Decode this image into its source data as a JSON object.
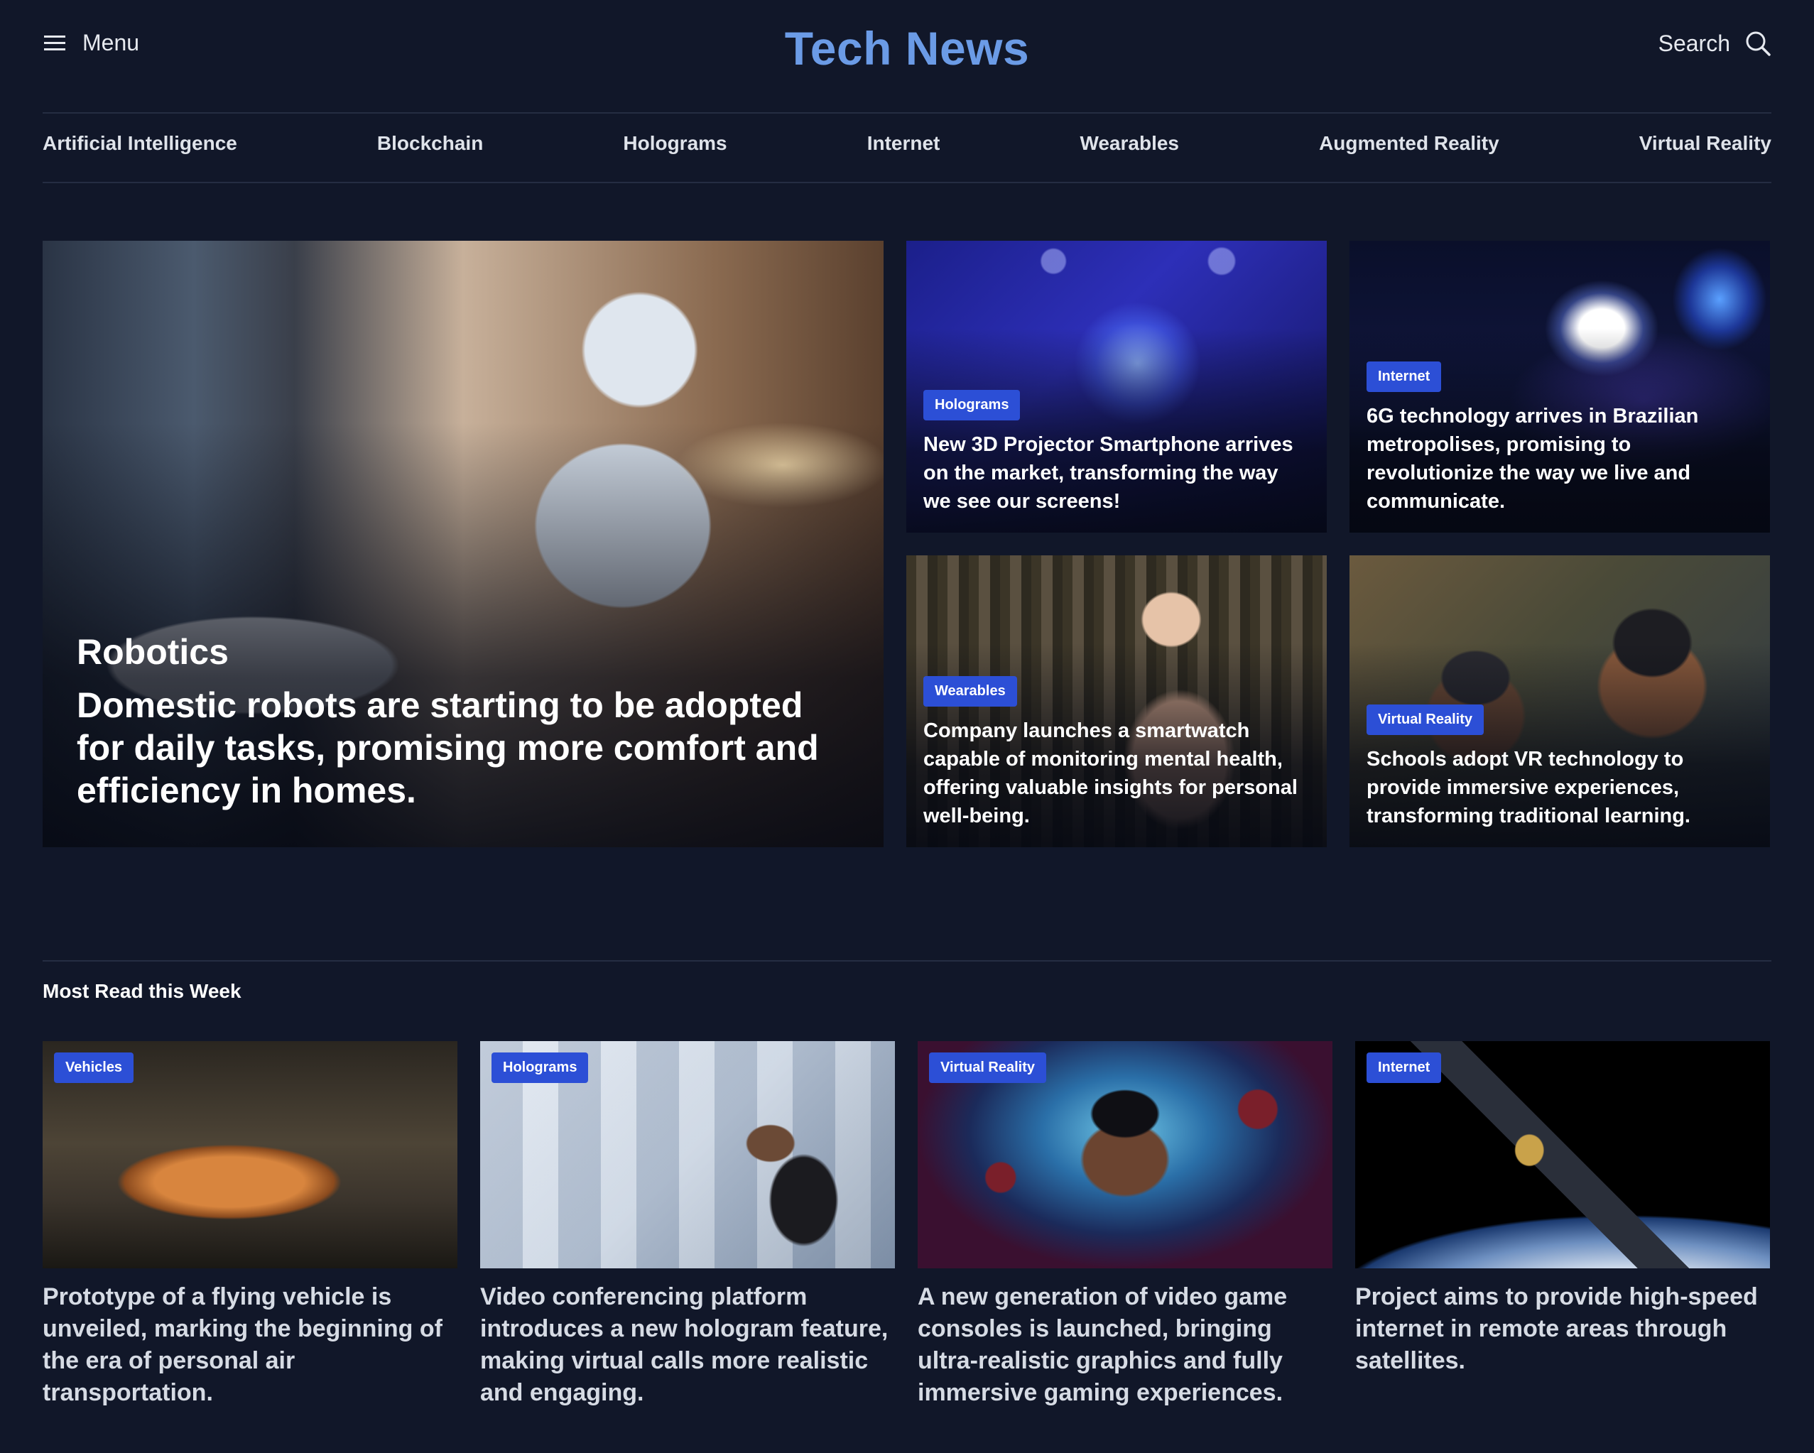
{
  "header": {
    "menu_label": "Menu",
    "logo": "Tech News",
    "search_label": "Search"
  },
  "nav": [
    "Artificial Intelligence",
    "Blockchain",
    "Holograms",
    "Internet",
    "Wearables",
    "Augmented Reality",
    "Virtual Reality"
  ],
  "featured": {
    "category": "Robotics",
    "title": "Domestic robots are starting to be adopted for daily tasks, promising more comfort and efficiency in homes."
  },
  "cards": [
    {
      "badge": "Holograms",
      "title": "New 3D Projector Smartphone arrives on the market, transforming the way we see our screens!"
    },
    {
      "badge": "Internet",
      "title": "6G technology arrives in Brazilian metropolises, promising to revolutionize the way we live and communicate."
    },
    {
      "badge": "Wearables",
      "title": "Company launches a smartwatch capable of monitoring mental health, offering valuable insights for personal well-being."
    },
    {
      "badge": "Virtual Reality",
      "title": "Schools adopt VR technology to provide immersive experiences, transforming traditional learning."
    }
  ],
  "most_read": {
    "title": "Most Read this Week",
    "items": [
      {
        "badge": "Vehicles",
        "title": "Prototype of a flying vehicle is unveiled, marking the beginning of the era of personal air transportation."
      },
      {
        "badge": "Holograms",
        "title": "Video conferencing platform introduces a new hologram feature, making virtual calls more realistic and engaging."
      },
      {
        "badge": "Virtual Reality",
        "title": "A new generation of video game consoles is launched, bringing ultra-realistic graphics and fully immersive gaming experiences."
      },
      {
        "badge": "Internet",
        "title": "Project aims to provide high-speed internet in remote areas through satellites."
      }
    ]
  },
  "colors": {
    "background": "#111729",
    "accent": "#6b9be6",
    "badge": "#2c4fd6"
  },
  "icons": {
    "menu": "hamburger-icon",
    "search": "search-icon"
  }
}
